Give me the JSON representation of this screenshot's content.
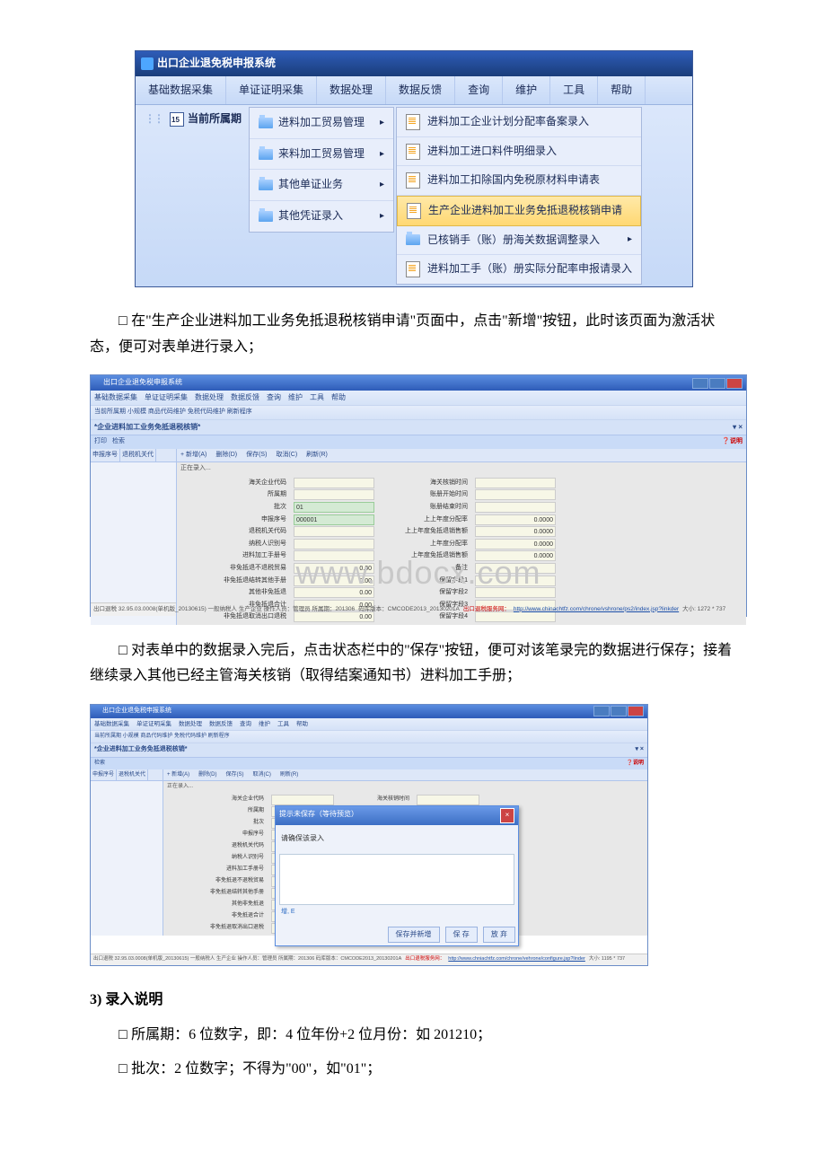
{
  "fig1": {
    "window_title": "出口企业退免税申报系统",
    "menubar": [
      "基础数据采集",
      "单证证明采集",
      "数据处理",
      "数据反馈",
      "查询",
      "维护",
      "工具",
      "帮助"
    ],
    "period_label": "当前所属期",
    "dropdown": [
      {
        "label": "进料加工贸易管理",
        "sub": true
      },
      {
        "label": "来料加工贸易管理",
        "sub": true
      },
      {
        "label": "其他单证业务",
        "sub": true
      },
      {
        "label": "其他凭证录入",
        "sub": true
      }
    ],
    "submenu": [
      {
        "icon": "doc",
        "label": "进料加工企业计划分配率备案录入"
      },
      {
        "icon": "doc",
        "label": "进料加工进口料件明细录入"
      },
      {
        "icon": "doc",
        "label": "进料加工扣除国内免税原材料申请表"
      },
      {
        "icon": "doc",
        "label": "生产企业进料加工业务免抵退税核销申请",
        "hl": true
      },
      {
        "icon": "folder",
        "label": "已核销手（账）册海关数据调整录入",
        "sub": true
      },
      {
        "icon": "doc",
        "label": "进料加工手（账）册实际分配率申报请录入"
      }
    ]
  },
  "para1": "在\"生产企业进料加工业务免抵退税核销申请\"页面中，点击\"新增\"按钮，此时该页面为激活状态，便可对表单进行录入；",
  "fig2": {
    "title": "出口企业退免税申报系统",
    "menu": [
      "基础数据采集",
      "单证证明采集",
      "数据处理",
      "数据反馈",
      "查询",
      "维护",
      "工具",
      "帮助"
    ],
    "crumb": "当前所属期  小规模  商品代码维护  免税代码维护  刷新程序",
    "tab": "*企业进料加工业务免抵退税核销*",
    "toolbar_left": [
      "打印",
      "检索"
    ],
    "help": "说明",
    "left_cols": [
      "申报序号",
      "退税机关代"
    ],
    "rtoolbar": [
      "+ 新增(A)",
      "删除(D)",
      "保存(S)",
      "取消(C)",
      "刷新(R)"
    ],
    "loading": "正在录入...",
    "rows": [
      [
        "海关企业代码",
        "",
        "海关核销时间",
        ""
      ],
      [
        "所属期",
        "",
        "账册开始时间",
        ""
      ],
      [
        "批次",
        "01",
        "账册结束时间",
        ""
      ],
      [
        "申报序号",
        "000001",
        "上上年度分配率",
        "0.0000"
      ],
      [
        "退税机关代码",
        "",
        "上上年度免抵退销售额",
        "0.0000"
      ],
      [
        "纳税人识别号",
        "",
        "上年度分配率",
        "0.0000"
      ],
      [
        "进料加工手册号",
        "",
        "上年度免抵退销售额",
        "0.0000"
      ],
      [
        "非免抵退不退税贸易",
        "0.00",
        "备注",
        ""
      ],
      [
        "非免抵退结转其他手册",
        "0.00",
        "保留字段1",
        ""
      ],
      [
        "其他非免抵退",
        "0.00",
        "保留字段2",
        ""
      ],
      [
        "非免抵退合计",
        "0.00",
        "保留字段3",
        ""
      ],
      [
        "非免抵退取消出口退税",
        "0.00",
        "保留字段4",
        ""
      ]
    ],
    "watermark": "www.bdocx.com",
    "status": {
      "a": "出口退税 32.95.03.0008(单机版_20130615)  一般纳税人  生产企业  操作人员：管理员  所属期：201306",
      "b": "码库版本：CMCODE2013_20130201A",
      "c": "出口退税服务网：",
      "link": "http://www.chinachtfz.com/chrone/vshrone/ps2/index.jsp?linkder",
      "d": "大小: 1272 * 737"
    }
  },
  "para2": "对表单中的数据录入完后，点击状态栏中的\"保存\"按钮，便可对该笔录完的数据进行保存；接着继续录入其他已经主管海关核销（取得结案通知书）进料加工手册；",
  "fig3": {
    "title": "出口企业退免税申报系统",
    "menu": [
      "基础数据采集",
      "单证证明采集",
      "数据处理",
      "数据反馈",
      "查询",
      "维护",
      "工具",
      "帮助"
    ],
    "crumb": "当前所属期  小规模  商品代码维护  免税代码维护  刷新程序",
    "tab": "*企业进料加工业务免抵退税核销*",
    "help": "说明",
    "left_cols": [
      "申报序号",
      "退税机关代"
    ],
    "rtoolbar": [
      "+ 新增(A)",
      "删除(D)",
      "保存(S)",
      "取消(C)",
      "刷新(R)"
    ],
    "loading": "正在录入...",
    "labels": [
      "海关企业代码",
      "所属期",
      "批次",
      "申报序号",
      "退税机关代码",
      "纳税人识别号",
      "进料加工手册号",
      "非免抵退不退税贸易",
      "非免抵退结转其他手册",
      "其他非免抵退",
      "非免抵退合计",
      "非免抵退取消出口退税"
    ],
    "right_label": "海关核销时间",
    "dialog": {
      "title": "提示未保存（等待预览）",
      "msg": "请确保该录入",
      "note": "增, E",
      "btns": [
        "保存并新增",
        "保 存",
        "放 弃"
      ]
    },
    "status": {
      "a": "出口退税 32.95.03.0008(单机版_20130615)  一般纳税人  生产企业  操作人员：管理员  所属期：201306  码库版本：CMCODE2013_20130201A",
      "c": "出口退税服务网：",
      "link": "http://www.chniachtfz.com/chrone/vehrone/configure.jsp?linder",
      "d": "大小: 1195 * 737"
    }
  },
  "heading": "3) 录入说明",
  "item1": "所属期：6 位数字，即：4 位年份+2 位月份：如 201210；",
  "item2": "批次：2 位数字；不得为\"00\"，如\"01\"；"
}
